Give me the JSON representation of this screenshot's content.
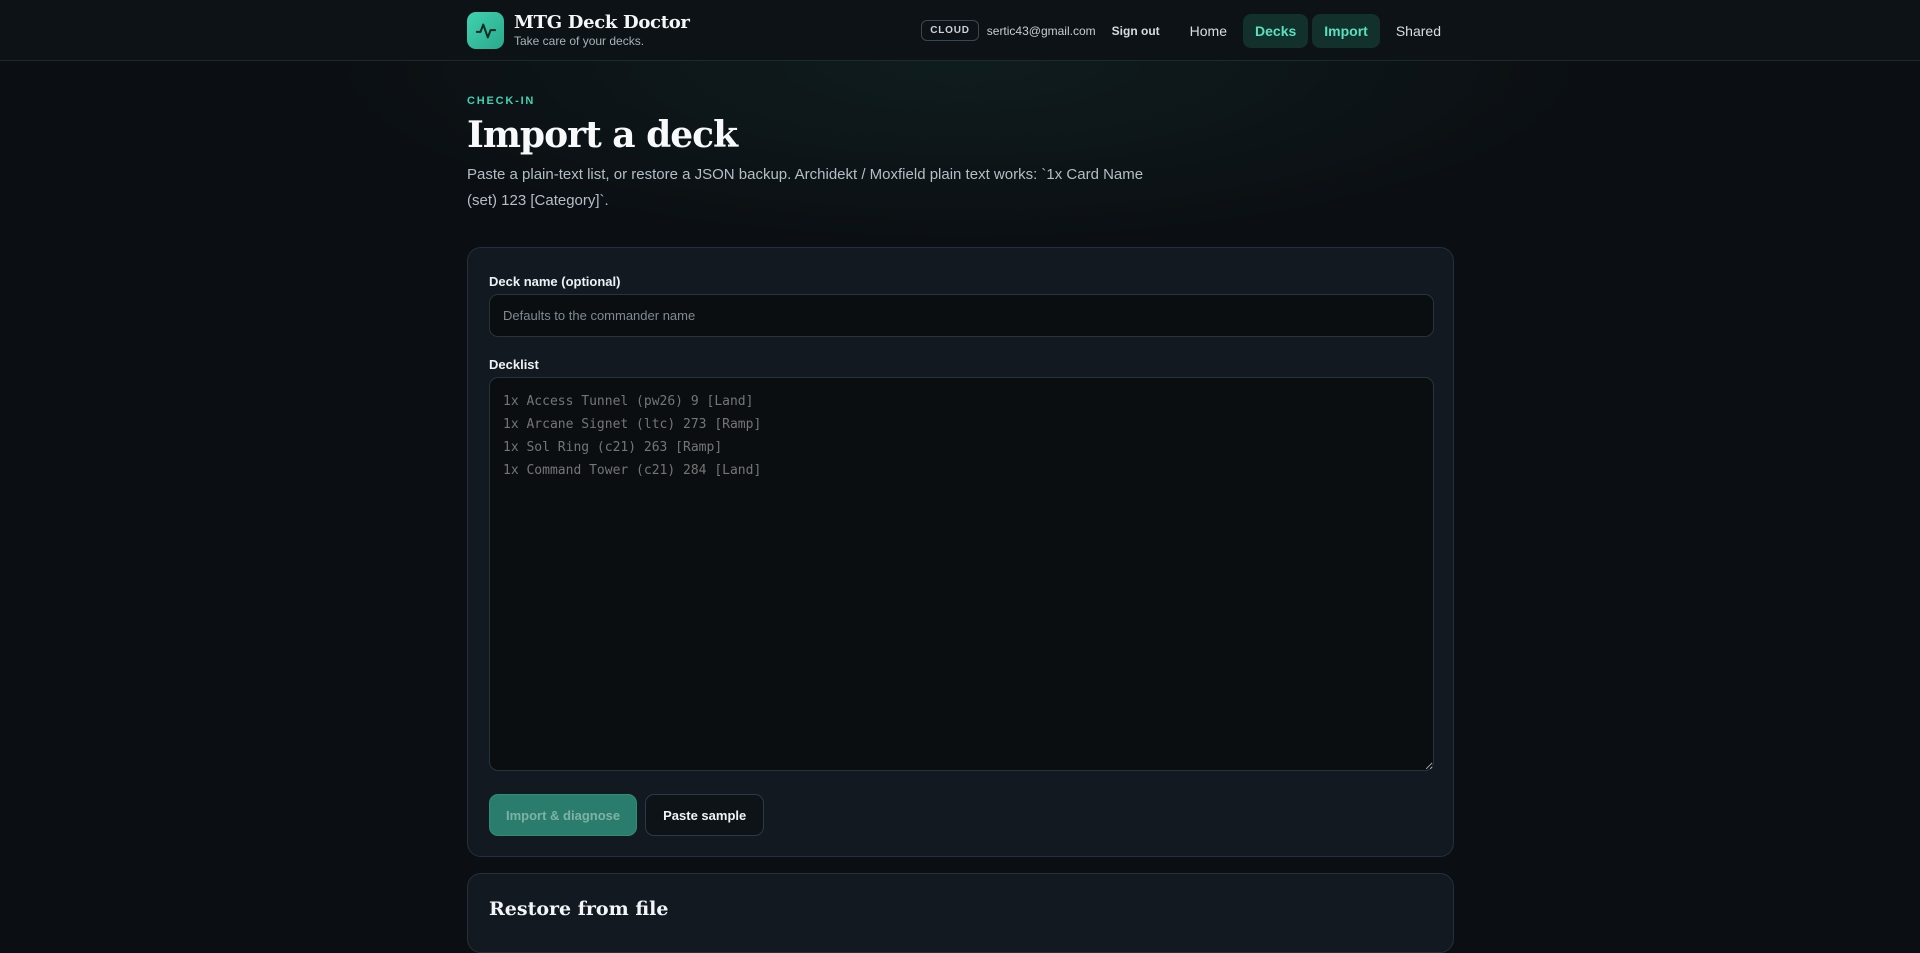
{
  "header": {
    "brand_title": "MTG Deck Doctor",
    "brand_subtitle": "Take care of your decks.",
    "cloud_badge": "CLOUD",
    "email": "sertic43@gmail.com",
    "sign_out": "Sign out",
    "nav": [
      {
        "label": "Home",
        "active": false
      },
      {
        "label": "Decks",
        "active": true
      },
      {
        "label": "Import",
        "active": true
      },
      {
        "label": "Shared",
        "active": false
      }
    ]
  },
  "page": {
    "eyebrow": "CHECK-IN",
    "title": "Import a deck",
    "intro": "Paste a plain-text list, or restore a JSON backup. Archidekt / Moxfield plain text works: `1x Card Name (set) 123 [Category]`."
  },
  "import_form": {
    "name_label": "Deck name (optional)",
    "name_placeholder": "Defaults to the commander name",
    "decklist_label": "Decklist",
    "decklist_placeholder": "1x Access Tunnel (pw26) 9 [Land]\n1x Arcane Signet (ltc) 273 [Ramp]\n1x Sol Ring (c21) 263 [Ramp]\n1x Command Tower (c21) 284 [Land]",
    "import_button": "Import & diagnose",
    "sample_button": "Paste sample"
  },
  "restore": {
    "title": "Restore from file"
  },
  "colors": {
    "accent": "#3fd3b0",
    "background": "#0b0f13",
    "card": "#121920"
  }
}
